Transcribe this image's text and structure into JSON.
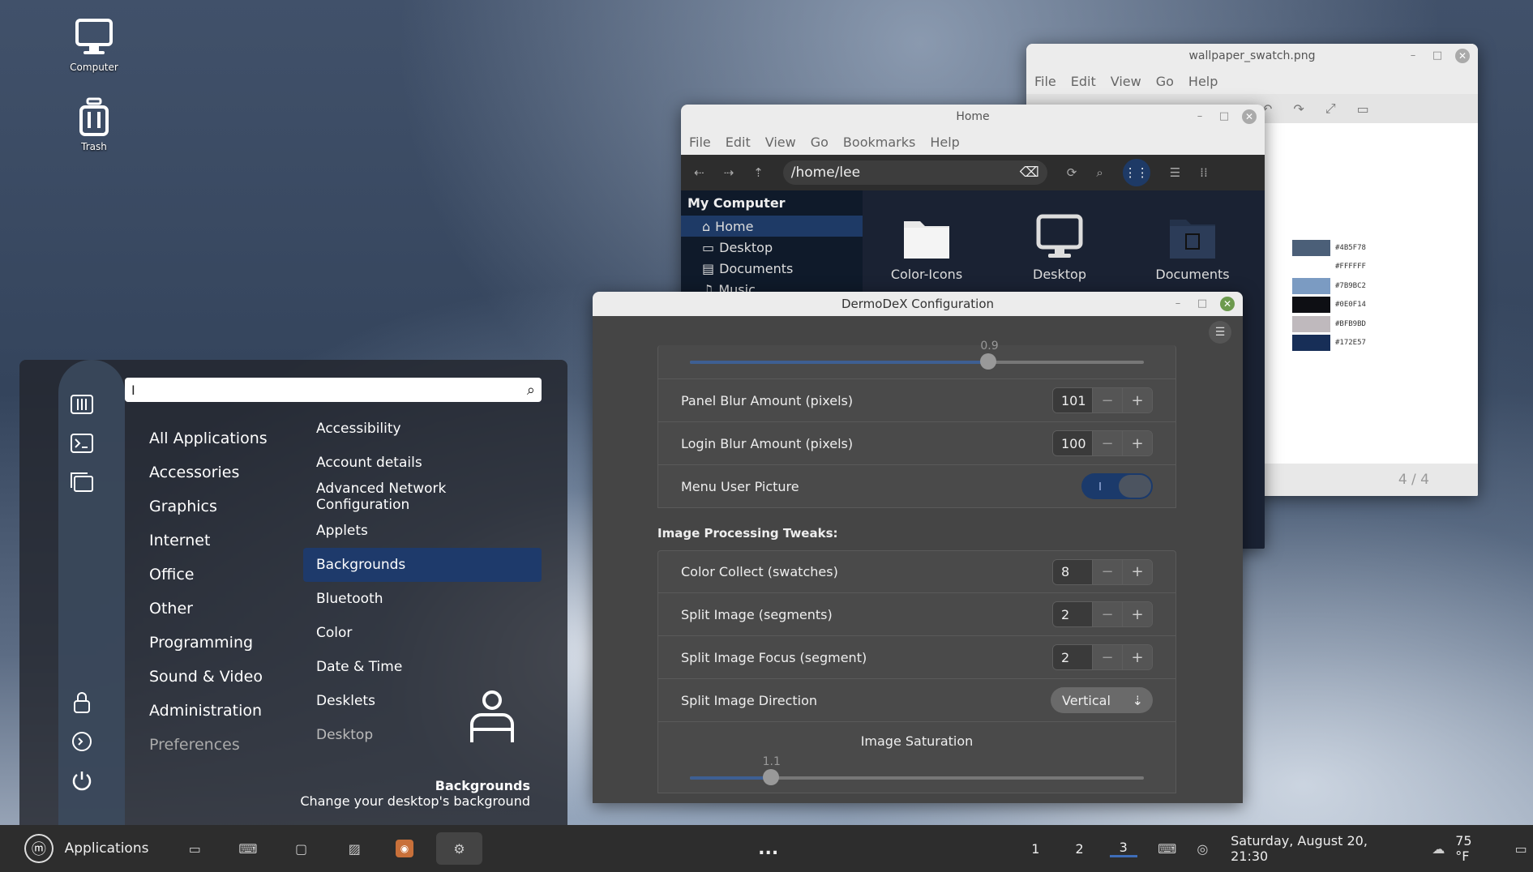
{
  "desktop": {
    "icons": [
      {
        "label": "Computer",
        "icon": "computer-icon"
      },
      {
        "label": "Trash",
        "icon": "trash-icon"
      }
    ]
  },
  "viewer": {
    "title": "wallpaper_swatch.png",
    "menu": [
      "File",
      "Edit",
      "View",
      "Go",
      "Help"
    ],
    "page_counter": "4 / 4",
    "swatches": [
      {
        "hex": "#4B5F78",
        "color": "#4B5F78"
      },
      {
        "hex": "#FFFFFF",
        "color": "#FFFFFF"
      },
      {
        "hex": "#7B9BC2",
        "color": "#7B9BC2"
      },
      {
        "hex": "#0E0F14",
        "color": "#0E0F14"
      },
      {
        "hex": "#BFB9BD",
        "color": "#BFB9BD"
      },
      {
        "hex": "#172E57",
        "color": "#172E57"
      }
    ]
  },
  "files": {
    "title": "Home",
    "menu": [
      "File",
      "Edit",
      "View",
      "Go",
      "Bookmarks",
      "Help"
    ],
    "path": "/home/lee",
    "sidebar_header": "My Computer",
    "sidebar": [
      "Home",
      "Desktop",
      "Documents",
      "Music"
    ],
    "items": [
      "Color-Icons",
      "Desktop",
      "Documents"
    ]
  },
  "config": {
    "title": "DermoDeX Configuration",
    "top_slider_value": "0.9",
    "rows1": [
      {
        "label": "Panel Blur Amount (pixels)",
        "value": "101"
      },
      {
        "label": "Login Blur Amount (pixels)",
        "value": "100"
      }
    ],
    "menu_user_picture": "Menu User Picture",
    "section": "Image Processing Tweaks:",
    "rows2": [
      {
        "label": "Color Collect (swatches)",
        "value": "8"
      },
      {
        "label": "Split Image (segments)",
        "value": "2"
      },
      {
        "label": "Split Image Focus (segment)",
        "value": "2"
      }
    ],
    "direction_label": "Split Image Direction",
    "direction_value": "Vertical",
    "saturation_label": "Image Saturation",
    "saturation_value": "1.1"
  },
  "menu": {
    "search_value": "I",
    "categories": [
      "All Applications",
      "Accessories",
      "Graphics",
      "Internet",
      "Office",
      "Other",
      "Programming",
      "Sound & Video",
      "Administration",
      "Preferences"
    ],
    "apps": [
      "Accessibility",
      "Account details",
      "Advanced Network Configuration",
      "Applets",
      "Backgrounds",
      "Bluetooth",
      "Color",
      "Date & Time",
      "Desklets",
      "Desktop"
    ],
    "selected_app": "Backgrounds",
    "selected_desc": "Change your desktop's background"
  },
  "taskbar": {
    "apps_label": "Applications",
    "more": "...",
    "workspaces": [
      "1",
      "2",
      "3"
    ],
    "datetime": "Saturday, August 20, 21:30",
    "weather": "75 °F"
  }
}
